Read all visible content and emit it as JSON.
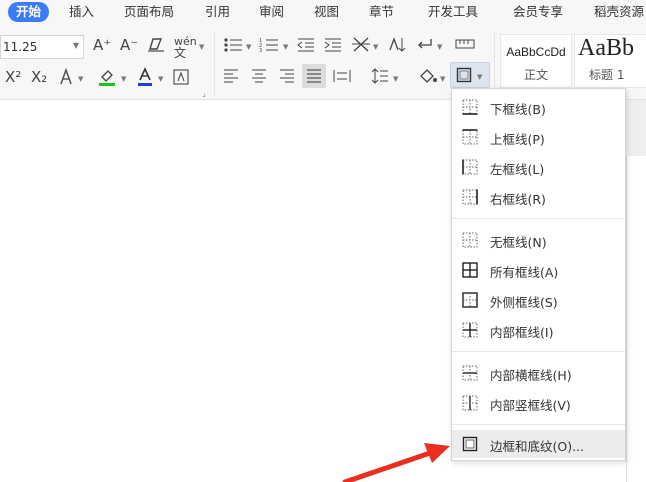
{
  "tabs": [
    {
      "label": "开始",
      "active": true
    },
    {
      "label": "插入"
    },
    {
      "label": "页面布局"
    },
    {
      "label": "引用"
    },
    {
      "label": "审阅"
    },
    {
      "label": "视图"
    },
    {
      "label": "章节"
    },
    {
      "label": "开发工具"
    },
    {
      "label": "会员专享"
    },
    {
      "label": "稻壳资源"
    }
  ],
  "ribbon": {
    "font_size": "11.25",
    "grow_font": "A⁺",
    "shrink_font": "A⁻",
    "phonetic": "wén",
    "superscript": "X²",
    "subscript": "X₂",
    "styles": [
      {
        "sample": "AaBbCcDd",
        "caption": "正文"
      },
      {
        "sample": "AaBb",
        "caption": "标题 1"
      }
    ]
  },
  "border_menu": {
    "items": [
      {
        "label": "下框线(B)",
        "icon": "border-bottom-icon"
      },
      {
        "label": "上框线(P)",
        "icon": "border-top-icon"
      },
      {
        "label": "左框线(L)",
        "icon": "border-left-icon"
      },
      {
        "label": "右框线(R)",
        "icon": "border-right-icon"
      },
      {
        "label": "无框线(N)",
        "icon": "border-none-icon"
      },
      {
        "label": "所有框线(A)",
        "icon": "border-all-icon"
      },
      {
        "label": "外侧框线(S)",
        "icon": "border-outside-icon"
      },
      {
        "label": "内部框线(I)",
        "icon": "border-inside-icon"
      },
      {
        "label": "内部横框线(H)",
        "icon": "border-inside-horizontal-icon"
      },
      {
        "label": "内部竖框线(V)",
        "icon": "border-inside-vertical-icon"
      },
      {
        "label": "边框和底纹(O)...",
        "icon": "border-shading-icon"
      }
    ]
  },
  "colors": {
    "accent": "#3b7cf6",
    "highlight_green": "#21c21a",
    "font_color_blue": "#1f3fd6",
    "annotation_red": "#ea2e1f"
  }
}
